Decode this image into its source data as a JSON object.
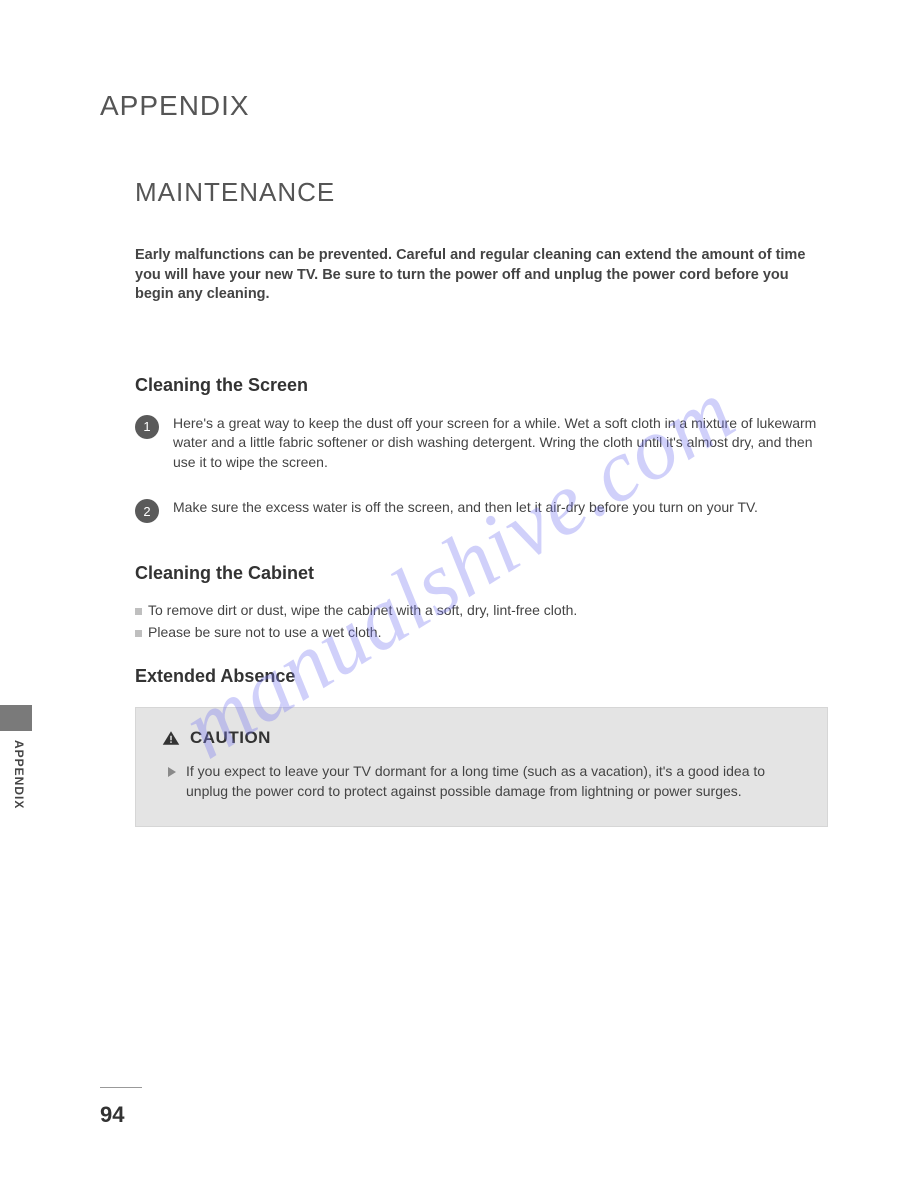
{
  "watermark": "manualshive.com",
  "header": {
    "appendix": "APPENDIX"
  },
  "main": {
    "title": "MAINTENANCE",
    "intro": "Early malfunctions can be prevented. Careful and regular cleaning can extend the amount of time you will have your new TV. Be sure to turn the power off and unplug the power cord before you begin any cleaning."
  },
  "sections": {
    "screen": {
      "heading": "Cleaning the Screen",
      "steps": [
        {
          "num": "1",
          "text": "Here's a great way to keep the dust off your screen for a while. Wet a soft cloth in a mixture of lukewarm water and a little fabric softener or dish washing detergent. Wring the cloth until it's almost dry, and then use it to wipe the screen."
        },
        {
          "num": "2",
          "text": "Make sure the excess water is off the screen, and then let it air-dry before you turn on your TV."
        }
      ]
    },
    "cabinet": {
      "heading": "Cleaning the Cabinet",
      "bullets": [
        "To remove dirt or dust, wipe the cabinet with a soft, dry, lint-free cloth.",
        "Please be sure not to use a wet cloth."
      ]
    },
    "absence": {
      "heading": "Extended Absence",
      "caution_label": "CAUTION",
      "caution_text": "If you expect to leave your TV dormant for a long time (such as a vacation), it's a good idea to unplug the power cord to protect against possible damage from lightning or power surges."
    }
  },
  "side": {
    "label": "APPENDIX"
  },
  "page_number": "94"
}
